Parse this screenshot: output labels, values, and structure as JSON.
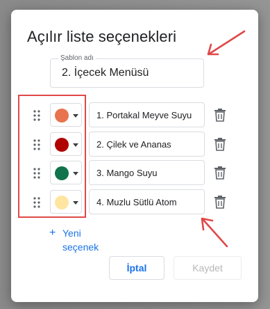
{
  "dialog": {
    "title": "Açılır liste seçenekleri",
    "template": {
      "label": "Şablon adı",
      "value": "2. İçecek Menüsü"
    },
    "options": [
      {
        "label": "1. Portakal Meyve Suyu",
        "color": "#e8734f"
      },
      {
        "label": "2. Çilek ve Ananas",
        "color": "#b10202"
      },
      {
        "label": "3. Mango Suyu",
        "color": "#11734b"
      },
      {
        "label": "4. Muzlu Sütlü Atom",
        "color": "#ffe5a0"
      }
    ],
    "add_option": {
      "icon": "+",
      "label": "Yeni seçenek"
    },
    "buttons": {
      "cancel": "İptal",
      "save": "Kaydet"
    }
  },
  "colors": {
    "accent": "#1a73e8",
    "annotation": "#e04848"
  }
}
